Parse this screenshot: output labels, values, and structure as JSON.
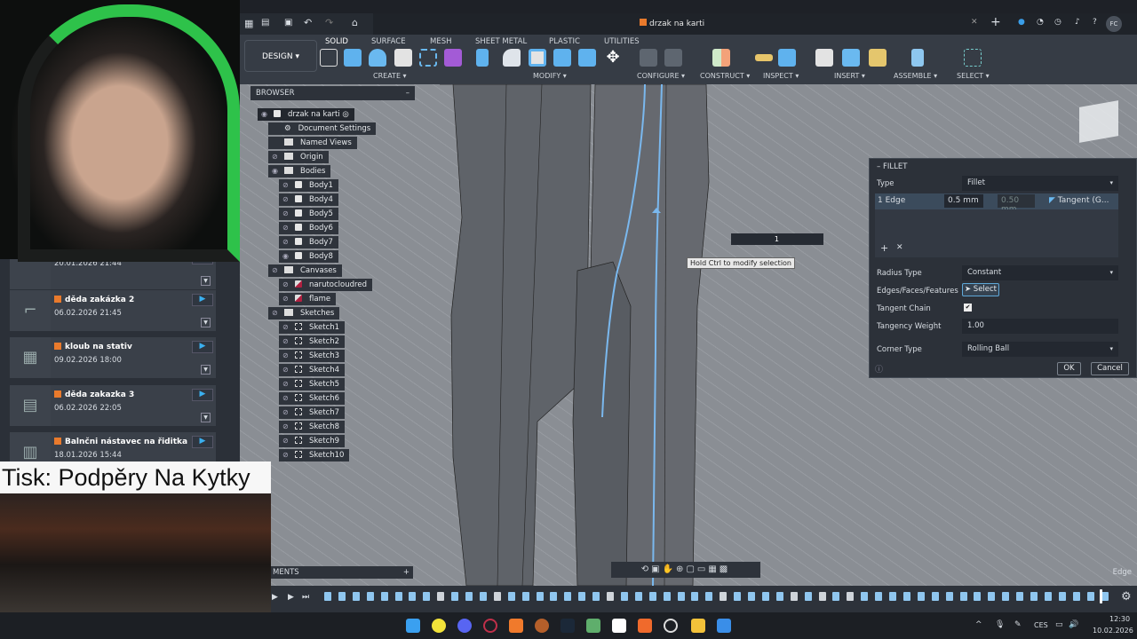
{
  "app": {
    "document_title": "drzak na karti",
    "user_initials": "FC",
    "mode": "DESIGN"
  },
  "toolbar": {
    "tabs": [
      "SOLID",
      "SURFACE",
      "MESH",
      "SHEET METAL",
      "PLASTIC",
      "UTILITIES"
    ],
    "groups": [
      "CREATE",
      "MODIFY",
      "CONFIGURE",
      "CONSTRUCT",
      "INSPECT",
      "INSERT",
      "ASSEMBLE",
      "SELECT"
    ]
  },
  "browser": {
    "title": "BROWSER",
    "root": "drzak na karti",
    "nodes": [
      "Document Settings",
      "Named Views",
      "Origin",
      "Bodies"
    ],
    "bodies": [
      "Body1",
      "Body4",
      "Body5",
      "Body6",
      "Body7",
      "Body8"
    ],
    "canvases_label": "Canvases",
    "canvases": [
      "narutocloudred",
      "flame"
    ],
    "sketches_label": "Sketches",
    "sketches": [
      "Sketch1",
      "Sketch2",
      "Sketch3",
      "Sketch4",
      "Sketch5",
      "Sketch6",
      "Sketch7",
      "Sketch8",
      "Sketch9",
      "Sketch10"
    ]
  },
  "fillet": {
    "title": "FILLET",
    "type_label": "Type",
    "type_value": "Fillet",
    "edge_label": "1 Edge",
    "radius": "0.5 mm",
    "radius2": "0.50 mm",
    "continuity": "Tangent (G...",
    "radius_type_label": "Radius Type",
    "radius_type_value": "Constant",
    "edges_label": "Edges/Faces/Features",
    "select_label": "Select",
    "tangent_chain_label": "Tangent Chain",
    "tangent_chain_checked": true,
    "tangency_weight_label": "Tangency Weight",
    "tangency_weight": "1.00",
    "corner_type_label": "Corner Type",
    "corner_type_value": "Rolling Ball",
    "ok": "OK",
    "cancel": "Cancel"
  },
  "viewport": {
    "tooltip": "Hold Ctrl to modify selection",
    "input_value": "1",
    "selection_status": "Edge",
    "comments_label": "MENTS"
  },
  "projects": [
    {
      "name": "",
      "date": "20.01.2026 21:44"
    },
    {
      "name": "děda zakázka 2",
      "date": "06.02.2026 21:45"
    },
    {
      "name": "kloub na stativ",
      "date": "09.02.2026 18:00"
    },
    {
      "name": "děda zakazka 3",
      "date": "06.02.2026 22:05"
    },
    {
      "name": "Balnčni nástavec na řiditka",
      "date": "18.01.2026 15:44"
    }
  ],
  "overlay": {
    "title": "Tisk: Podpěry Na Kytky"
  },
  "taskbar": {
    "language": "CES",
    "time": "12:30",
    "date": "10.02.2026"
  },
  "colors": {
    "accent": "#3a9ee8",
    "selection": "#6fb6ef",
    "project_icon": "#e97a2c"
  }
}
